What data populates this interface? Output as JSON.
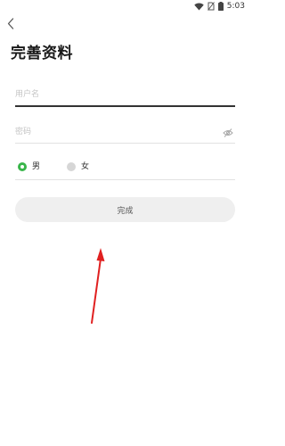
{
  "status_bar": {
    "time": "5:03",
    "icons": [
      "wifi-icon",
      "no-sim-icon",
      "battery-icon"
    ]
  },
  "header": {
    "back_icon": "chevron-left-icon",
    "title": "完善资料"
  },
  "form": {
    "username": {
      "placeholder": "用户名",
      "value": ""
    },
    "password": {
      "placeholder": "密码",
      "value": "",
      "toggle_icon": "eye-off-icon"
    },
    "gender": {
      "options": [
        {
          "label": "男",
          "selected": true
        },
        {
          "label": "女",
          "selected": false
        }
      ]
    },
    "submit_label": "完成"
  },
  "colors": {
    "accent_selected": "#39b54a",
    "button_bg": "#efefef",
    "annotation_arrow": "#e02020"
  }
}
